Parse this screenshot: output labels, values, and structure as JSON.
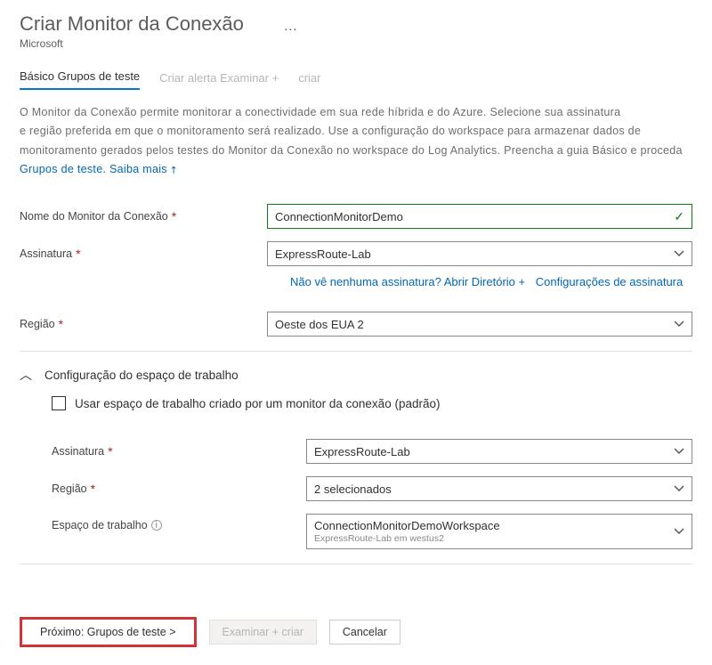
{
  "header": {
    "title": "Criar Monitor da Conexão",
    "subtitle": "Microsoft",
    "more": "…"
  },
  "tabs": {
    "basics": "Básico",
    "testgroups": "Grupos de teste",
    "createalert": "Criar alerta",
    "review": "Examinar +",
    "create": "criar"
  },
  "description": {
    "line1": "O Monitor da Conexão permite monitorar a conectividade em sua rede híbrida e do Azure. Selecione sua assinatura",
    "line2": "e região preferida em que o monitoramento será realizado. Use a configuração do workspace para armazenar dados de",
    "line3": " monitoramento gerados pelos testes do Monitor da Conexão no workspace do Log Analytics. Preencha a guia Básico e proceda",
    "learn1": "Grupos de teste.",
    "learn2": "Saiba mais"
  },
  "labels": {
    "name": "Nome do Monitor da Conexão",
    "subscription": "Assinatura",
    "region": "Região",
    "workspaceHeader": "Configuração do espaço de trabalho",
    "useDefault": "Usar espaço de trabalho criado por um monitor da conexão (padrão)",
    "ws_subscription": "Assinatura",
    "ws_region": "Região",
    "ws_space": "Espaço de trabalho"
  },
  "values": {
    "name": "ConnectionMonitorDemo",
    "subscription": "ExpressRoute-Lab",
    "region": "Oeste dos EUA 2",
    "ws_subscription": "ExpressRoute-Lab",
    "ws_region": "2 selecionados",
    "ws_space": "ConnectionMonitorDemoWorkspace",
    "ws_space_sub": "ExpressRoute-Lab em westus2"
  },
  "links": {
    "nosub": "Não vê nenhuma assinatura? Abrir Diretório +",
    "subsettings": "Configurações de assinatura"
  },
  "footer": {
    "next": "Próximo: Grupos de teste >",
    "review": "Examinar + criar",
    "cancel": "Cancelar"
  }
}
